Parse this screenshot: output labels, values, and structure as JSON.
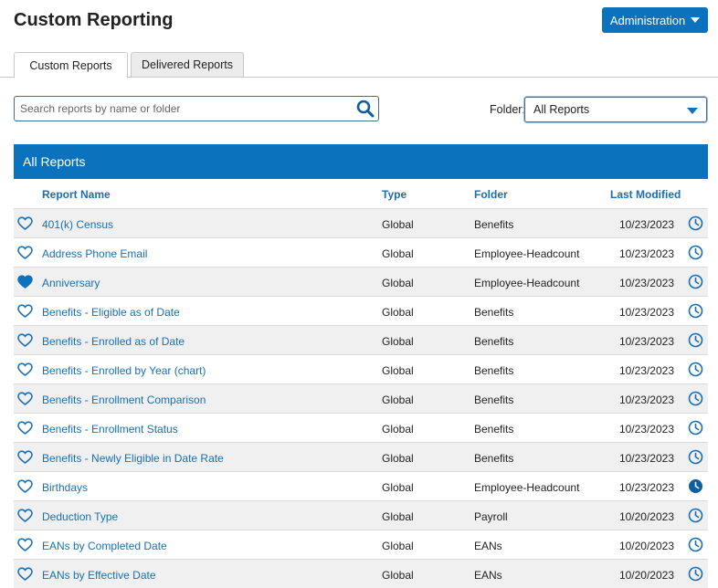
{
  "header": {
    "title": "Custom Reporting",
    "admin_button": "Administration"
  },
  "tabs": [
    {
      "label": "Custom Reports",
      "active": true
    },
    {
      "label": "Delivered Reports",
      "active": false
    }
  ],
  "search": {
    "placeholder": "Search reports by name or folder",
    "value": ""
  },
  "folder_filter": {
    "label": "Folder:",
    "selected": "All Reports"
  },
  "panel": {
    "title": "All Reports"
  },
  "columns": {
    "name": "Report Name",
    "type": "Type",
    "folder": "Folder",
    "modified": "Last Modified"
  },
  "colors": {
    "accent": "#0b72bd",
    "link": "#1a6fb0",
    "row_shade": "#f0f0f0"
  },
  "icons": {
    "favorite": "heart-icon",
    "history": "clock-icon",
    "search": "search-icon"
  },
  "reports": [
    {
      "name": "401(k) Census",
      "type": "Global",
      "folder": "Benefits",
      "modified": "10/23/2023",
      "favorite": false,
      "clock_filled": false
    },
    {
      "name": "Address Phone Email",
      "type": "Global",
      "folder": "Employee-Headcount",
      "modified": "10/23/2023",
      "favorite": false,
      "clock_filled": false
    },
    {
      "name": "Anniversary",
      "type": "Global",
      "folder": "Employee-Headcount",
      "modified": "10/23/2023",
      "favorite": true,
      "clock_filled": false
    },
    {
      "name": "Benefits - Eligible as of Date",
      "type": "Global",
      "folder": "Benefits",
      "modified": "10/23/2023",
      "favorite": false,
      "clock_filled": false
    },
    {
      "name": "Benefits - Enrolled as of Date",
      "type": "Global",
      "folder": "Benefits",
      "modified": "10/23/2023",
      "favorite": false,
      "clock_filled": false
    },
    {
      "name": "Benefits - Enrolled by Year (chart)",
      "type": "Global",
      "folder": "Benefits",
      "modified": "10/23/2023",
      "favorite": false,
      "clock_filled": false
    },
    {
      "name": "Benefits - Enrollment Comparison",
      "type": "Global",
      "folder": "Benefits",
      "modified": "10/23/2023",
      "favorite": false,
      "clock_filled": false
    },
    {
      "name": "Benefits - Enrollment Status",
      "type": "Global",
      "folder": "Benefits",
      "modified": "10/23/2023",
      "favorite": false,
      "clock_filled": false
    },
    {
      "name": "Benefits - Newly Eligible in Date Rate",
      "type": "Global",
      "folder": "Benefits",
      "modified": "10/23/2023",
      "favorite": false,
      "clock_filled": false
    },
    {
      "name": "Birthdays",
      "type": "Global",
      "folder": "Employee-Headcount",
      "modified": "10/23/2023",
      "favorite": false,
      "clock_filled": true
    },
    {
      "name": "Deduction Type",
      "type": "Global",
      "folder": "Payroll",
      "modified": "10/20/2023",
      "favorite": false,
      "clock_filled": false
    },
    {
      "name": "EANs by Completed Date",
      "type": "Global",
      "folder": "EANs",
      "modified": "10/20/2023",
      "favorite": false,
      "clock_filled": false
    },
    {
      "name": "EANs by Effective Date",
      "type": "Global",
      "folder": "EANs",
      "modified": "10/20/2023",
      "favorite": false,
      "clock_filled": false
    }
  ]
}
